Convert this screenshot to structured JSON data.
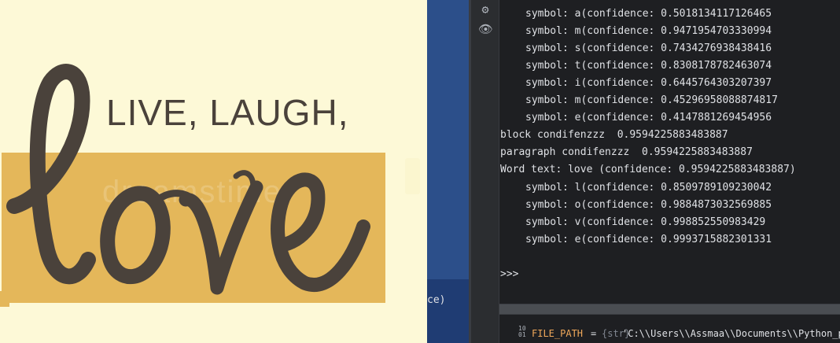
{
  "image_pane": {
    "headline": "LIVE, LAUGH,",
    "script_word": "love",
    "watermark": "dreamstime"
  },
  "middle_strip": {
    "text": "ce)"
  },
  "tool_rail": {
    "icons": [
      "settings-icon",
      "eye-icon"
    ]
  },
  "console": {
    "lines": [
      "symbol: a(confidence: 0.5018134117126465",
      "symbol: m(confidence: 0.9471954703330994",
      "symbol: s(confidence: 0.7434276938438416",
      "symbol: t(confidence: 0.8308178782463074",
      "symbol: i(confidence: 0.6445764303207397",
      "symbol: m(confidence: 0.45296958088874817",
      "symbol: e(confidence: 0.4147881269454956",
      "block condifenzzz  0.9594225883483887",
      "paragraph condifenzzz  0.9594225883483887",
      "Word text: love (confidence: 0.9594225883483887)",
      "symbol: l(confidence: 0.8509789109230042",
      "symbol: o(confidence: 0.9884873032569885",
      "symbol: v(confidence: 0.998852550983429",
      "symbol: e(confidence: 0.9993715882301331"
    ],
    "prompt": ">>>"
  },
  "variable": {
    "icon_top": "10",
    "icon_bottom": "01",
    "name": "FILE_PATH",
    "equals": "=",
    "type": "{str}",
    "value": "'C:\\\\Users\\\\Assmaa\\\\Documents\\\\Python_pro"
  },
  "colors": {
    "image_background": "#fdf9d7",
    "band": "#e4b75a",
    "ink": "#4a423b",
    "console_background": "#1e1f22",
    "middle_strip": "#2c4f8a",
    "variable_name": "#f0a85a"
  }
}
